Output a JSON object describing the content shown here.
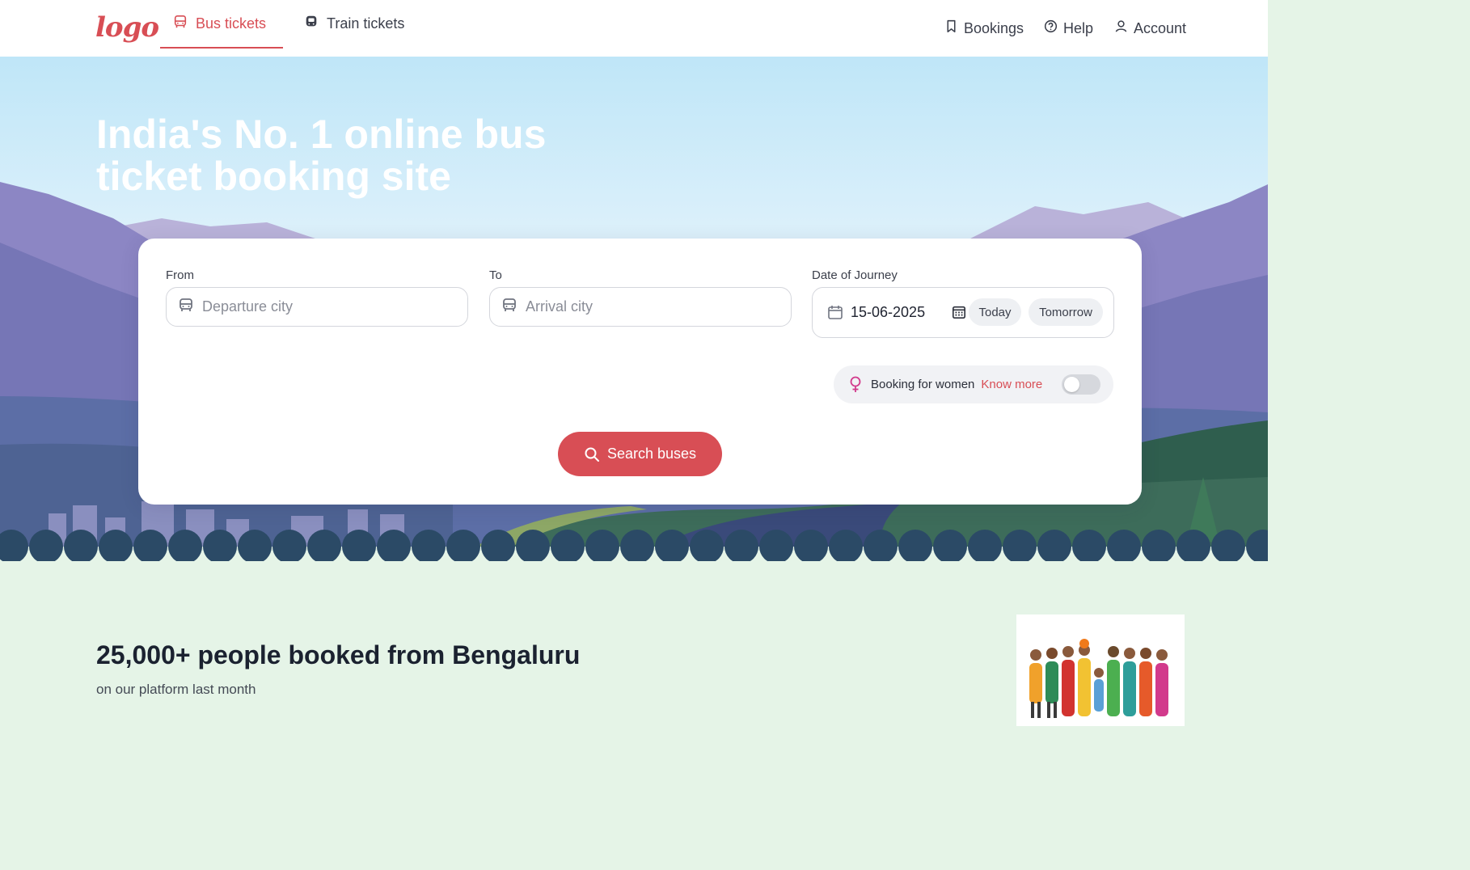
{
  "header": {
    "logo": "logo",
    "tabs": [
      {
        "label": "Bus tickets",
        "icon": "bus-icon",
        "active": true
      },
      {
        "label": "Train tickets",
        "icon": "train-icon",
        "active": false
      }
    ],
    "nav": {
      "bookings": {
        "label": "Bookings",
        "icon": "bookmark-icon"
      },
      "help": {
        "label": "Help",
        "icon": "help-circle-icon"
      },
      "account": {
        "label": "Account",
        "icon": "user-icon"
      }
    }
  },
  "hero": {
    "headline": "India's No. 1 online bus ticket booking site"
  },
  "search": {
    "from": {
      "label": "From",
      "placeholder": "Departure city",
      "value": "",
      "icon": "bus-icon"
    },
    "to": {
      "label": "To",
      "placeholder": "Arrival city",
      "value": "",
      "icon": "bus-icon"
    },
    "date": {
      "label": "Date of Journey",
      "value": "15-06-2025",
      "icon": "calendar-icon",
      "picker_icon": "calendar-grid-icon"
    },
    "quick_dates": [
      "Today",
      "Tomorrow"
    ],
    "women": {
      "label": "Booking for women",
      "link": "Know more",
      "icon": "female-icon",
      "enabled": false
    },
    "button": {
      "label": "Search buses",
      "icon": "search-icon"
    }
  },
  "stats": {
    "title": "25,000+ people booked from Bengaluru",
    "subtitle": "on our platform last month"
  },
  "colors": {
    "accent": "#d84e55",
    "section_bg": "#e5f4e7",
    "sky": "#c4e8f8"
  }
}
